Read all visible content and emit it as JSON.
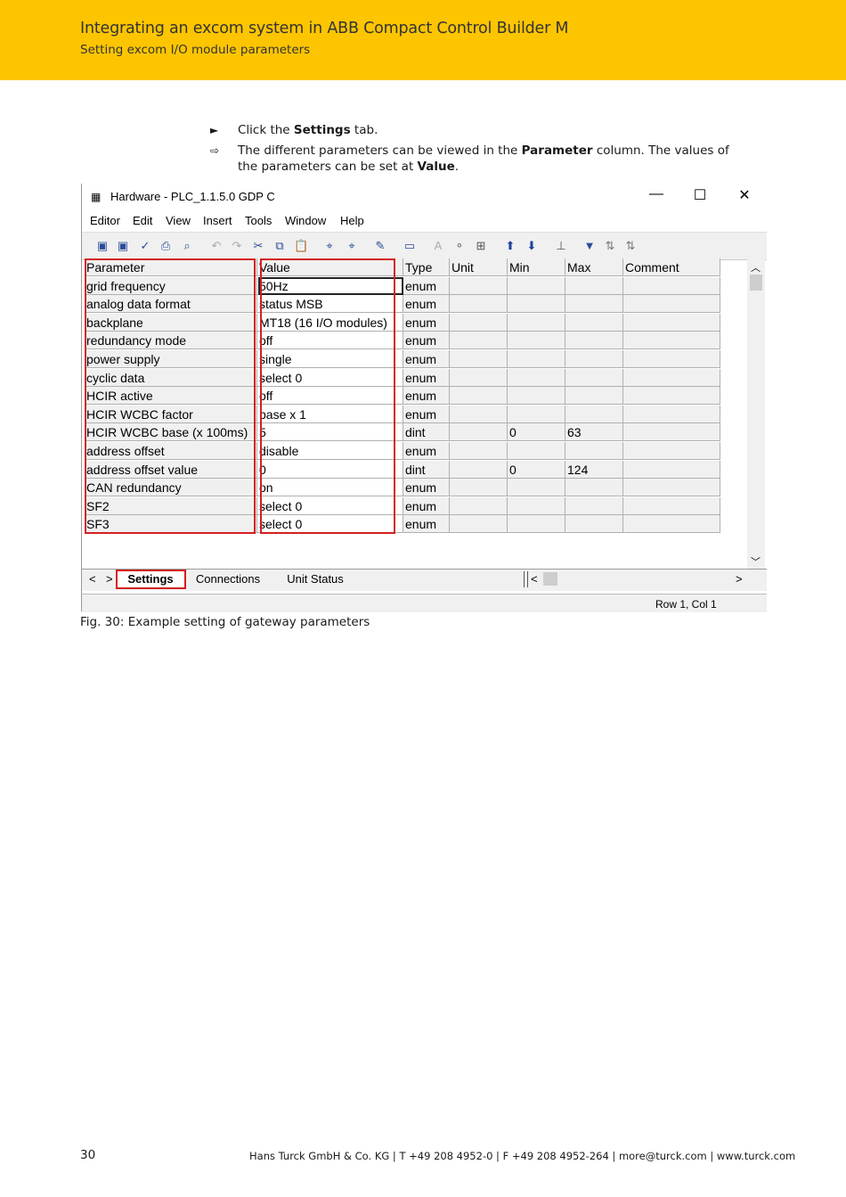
{
  "header": {
    "title": "Integrating an excom system in ABB Compact Control Builder M",
    "subtitle": "Setting excom I/O module parameters"
  },
  "steps": [
    {
      "bullet": "►",
      "pre": "Click the ",
      "bold": "Settings",
      "post": " tab."
    },
    {
      "bullet": "⇨",
      "pre": "The different parameters can be viewed in the ",
      "bold": "Parameter",
      "mid": " column. The values of the parameters can be set at ",
      "bold2": "Value",
      "post": "."
    }
  ],
  "window": {
    "title": "Hardware - PLC_1.1.5.0  GDP C",
    "menu": [
      "Editor",
      "Edit",
      "View",
      "Insert",
      "Tools",
      "Window",
      "Help"
    ],
    "columns": [
      "Parameter",
      "Value",
      "Type",
      "Unit",
      "Min",
      "Max",
      "Comment"
    ],
    "rows": [
      [
        "grid frequency",
        "50Hz",
        "enum",
        "",
        "",
        "",
        ""
      ],
      [
        "analog data format",
        "status MSB",
        "enum",
        "",
        "",
        "",
        ""
      ],
      [
        "backplane",
        "MT18 (16 I/O modules)",
        "enum",
        "",
        "",
        "",
        ""
      ],
      [
        "redundancy mode",
        "off",
        "enum",
        "",
        "",
        "",
        ""
      ],
      [
        "power supply",
        "single",
        "enum",
        "",
        "",
        "",
        ""
      ],
      [
        "cyclic data",
        "select 0",
        "enum",
        "",
        "",
        "",
        ""
      ],
      [
        "HCIR active",
        "off",
        "enum",
        "",
        "",
        "",
        ""
      ],
      [
        "HCIR WCBC factor",
        "base x 1",
        "enum",
        "",
        "",
        "",
        ""
      ],
      [
        "HCIR WCBC base (x 100ms)",
        "5",
        "dint",
        "",
        "0",
        "63",
        ""
      ],
      [
        "address offset",
        "disable",
        "enum",
        "",
        "",
        "",
        ""
      ],
      [
        "address offset value",
        "0",
        "dint",
        "",
        "0",
        "124",
        ""
      ],
      [
        "CAN redundancy",
        "on",
        "enum",
        "",
        "",
        "",
        ""
      ],
      [
        "SF2",
        "select 0",
        "enum",
        "",
        "",
        "",
        ""
      ],
      [
        "SF3",
        "select 0",
        "enum",
        "",
        "",
        "",
        ""
      ]
    ],
    "tabs": [
      "Settings",
      "Connections",
      "Unit Status"
    ],
    "status": "Row 1, Col 1"
  },
  "caption": "Fig. 30: Example setting of gateway parameters",
  "footer": {
    "page": "30",
    "address": "Hans Turck GmbH & Co. KG | T +49 208 4952-0 | F +49 208 4952-264 | more@turck.com | www.turck.com"
  }
}
